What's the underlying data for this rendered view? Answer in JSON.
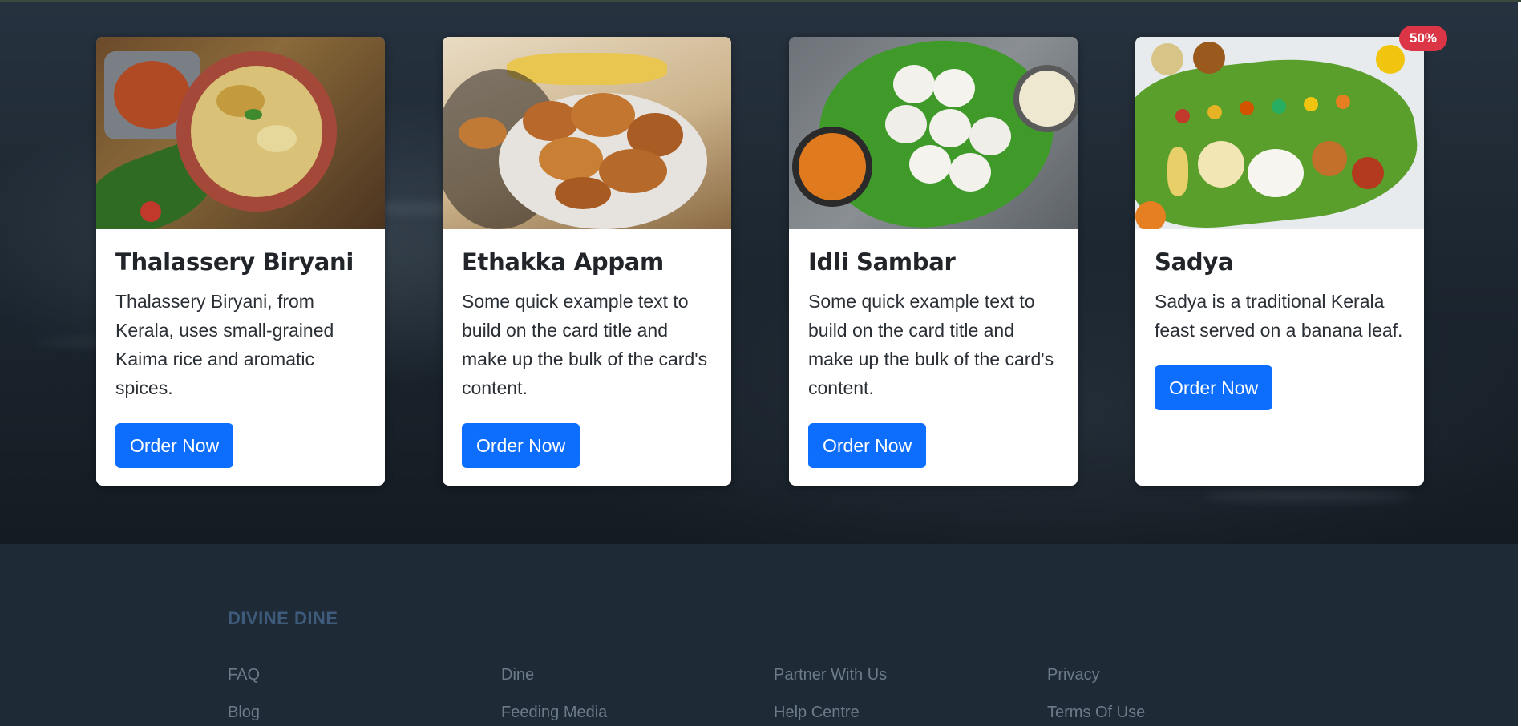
{
  "cards": [
    {
      "title": "Thalassery Biryani",
      "text": "Thalassery Biryani, from Kerala, uses small-grained Kaima rice and aromatic spices.",
      "button": "Order Now",
      "image": "biryani-photo"
    },
    {
      "title": "Ethakka Appam",
      "text": "Some quick example text to build on the card title and make up the bulk of the card's content.",
      "button": "Order Now",
      "image": "banana-fritters-photo"
    },
    {
      "title": "Idli Sambar",
      "text": "Some quick example text to build on the card title and make up the bulk of the card's content.",
      "button": "Order Now",
      "image": "idli-sambar-photo"
    },
    {
      "title": "Sadya",
      "text": "Sadya is a traditional Kerala feast served on a banana leaf.",
      "button": "Order Now",
      "image": "sadya-feast-photo",
      "badge": "50%"
    }
  ],
  "footer": {
    "brand": "DIVINE DINE",
    "columns": [
      [
        "FAQ",
        "Blog"
      ],
      [
        "Dine",
        "Feeding Media"
      ],
      [
        "Partner With Us",
        "Help Centre"
      ],
      [
        "Privacy",
        "Terms Of Use"
      ]
    ]
  },
  "colors": {
    "button": "#0d6efd",
    "badge": "#dc3545",
    "footer_bg": "#1f2a37",
    "brand": "#3f5b7b"
  }
}
